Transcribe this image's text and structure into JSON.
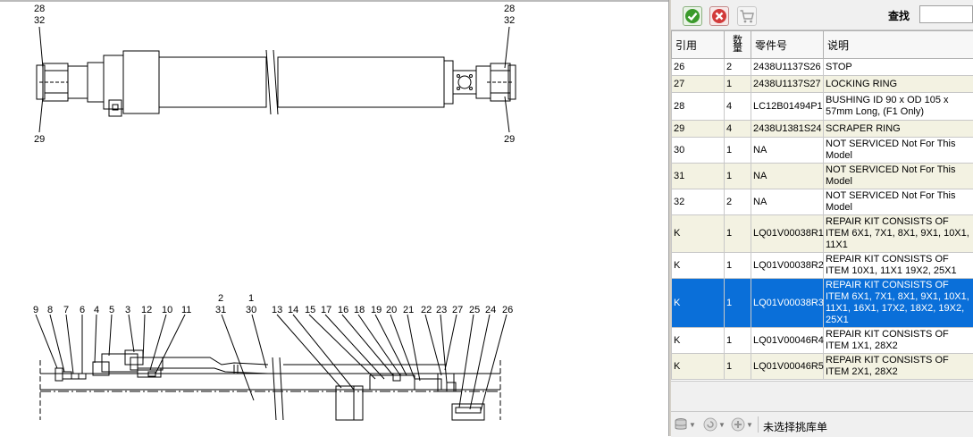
{
  "drawing": {
    "top_callouts_left": [
      "28",
      "32",
      "29"
    ],
    "top_callouts_right": [
      "28",
      "32",
      "29"
    ],
    "bottom_callouts_upper": [
      "2",
      "1"
    ],
    "bottom_callouts_lower": [
      "31",
      "30"
    ],
    "bottom_callouts_row": [
      "9",
      "8",
      "7",
      "6",
      "4",
      "5",
      "3",
      "12",
      "10",
      "11",
      "13",
      "14",
      "15",
      "17",
      "16",
      "18",
      "19",
      "20",
      "21",
      "22",
      "23",
      "27",
      "25",
      "24",
      "26"
    ]
  },
  "toolbar": {
    "confirm_icon": "green-check-icon",
    "cancel_icon": "red-x-icon",
    "cart_icon": "shopping-cart-icon",
    "search_label": "查找",
    "search_value": ""
  },
  "table": {
    "headers": {
      "ref": "引用",
      "qty_top": "数",
      "qty_bottom": "量",
      "part": "零件号",
      "desc": "说明"
    },
    "rows": [
      {
        "ref": "26",
        "qty": "2",
        "part": "2438U1137S26",
        "desc": "STOP",
        "style": "plain"
      },
      {
        "ref": "27",
        "qty": "1",
        "part": "2438U1137S27",
        "desc": "LOCKING RING",
        "style": "alt"
      },
      {
        "ref": "28",
        "qty": "4",
        "part": "LC12B01494P1",
        "desc": "BUSHING ID 90 x OD 105 x 57mm Long, (F1 Only)",
        "style": "plain"
      },
      {
        "ref": "29",
        "qty": "4",
        "part": "2438U1381S24",
        "desc": "SCRAPER RING",
        "style": "alt"
      },
      {
        "ref": "30",
        "qty": "1",
        "part": "NA",
        "desc": "NOT SERVICED Not For This Model",
        "style": "plain"
      },
      {
        "ref": "31",
        "qty": "1",
        "part": "NA",
        "desc": "NOT SERVICED Not For This Model",
        "style": "alt"
      },
      {
        "ref": "32",
        "qty": "2",
        "part": "NA",
        "desc": "NOT SERVICED Not For This Model",
        "style": "plain"
      },
      {
        "ref": "K",
        "qty": "1",
        "part": "LQ01V00038R1",
        "desc": "REPAIR KIT CONSISTS OF ITEM 6X1, 7X1, 8X1, 9X1, 10X1, 11X1",
        "style": "alt"
      },
      {
        "ref": "K",
        "qty": "1",
        "part": "LQ01V00038R2",
        "desc": "REPAIR KIT CONSISTS OF ITEM 10X1, 11X1 19X2, 25X1",
        "style": "plain"
      },
      {
        "ref": "K",
        "qty": "1",
        "part": "LQ01V00038R3",
        "desc": "REPAIR KIT CONSISTS OF ITEM 6X1, 7X1, 8X1, 9X1, 10X1, 11X1, 16X1, 17X2, 18X2, 19X2, 25X1",
        "style": "sel"
      },
      {
        "ref": "K",
        "qty": "1",
        "part": "LQ01V00046R4",
        "desc": "REPAIR KIT CONSISTS OF ITEM 1X1, 28X2",
        "style": "plain"
      },
      {
        "ref": "K",
        "qty": "1",
        "part": "LQ01V00046R5",
        "desc": "REPAIR KIT CONSISTS OF ITEM 2X1, 28X2",
        "style": "alt"
      }
    ]
  },
  "status": {
    "text": "未选择挑库单",
    "icon1": "database-stack-icon",
    "icon2": "refresh-circle-icon",
    "icon3": "add-circle-icon"
  },
  "colors": {
    "selected_row": "#0a6fd9",
    "alt_row": "#f3f2e2"
  }
}
